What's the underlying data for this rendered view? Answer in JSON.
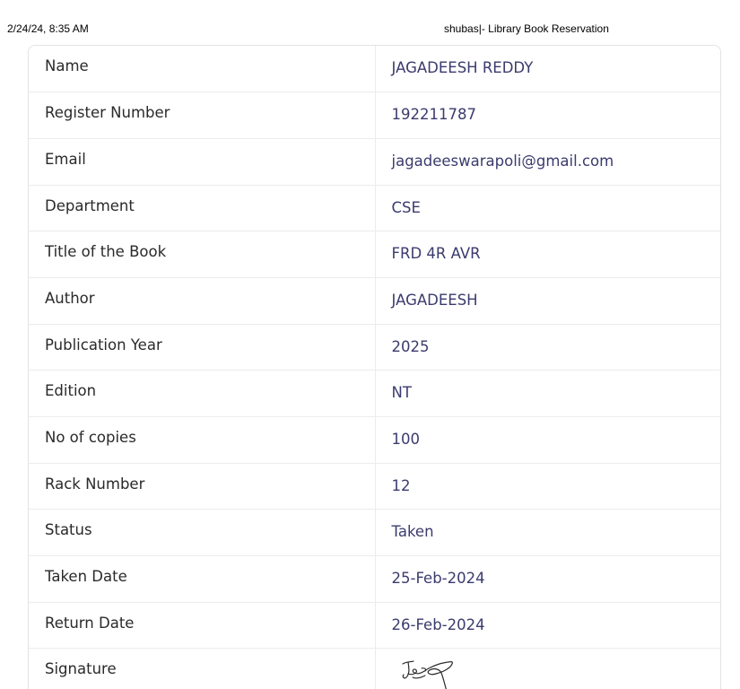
{
  "print_header": {
    "datetime": "2/24/24, 8:35 AM",
    "title": "shubas|- Library Book Reservation"
  },
  "reservation": {
    "rows": [
      {
        "label": "Name",
        "value": "JAGADEESH REDDY"
      },
      {
        "label": "Register Number",
        "value": "192211787"
      },
      {
        "label": "Email",
        "value": "jagadeeswarapoli@gmail.com"
      },
      {
        "label": "Department",
        "value": "CSE"
      },
      {
        "label": "Title of the Book",
        "value": "FRD 4R AVR"
      },
      {
        "label": "Author",
        "value": "JAGADEESH"
      },
      {
        "label": "Publication Year",
        "value": "2025"
      },
      {
        "label": "Edition",
        "value": "NT"
      },
      {
        "label": "No of copies",
        "value": "100"
      },
      {
        "label": "Rack Number",
        "value": "12"
      },
      {
        "label": "Status",
        "value": "Taken"
      },
      {
        "label": "Taken Date",
        "value": "25-Feb-2024"
      },
      {
        "label": "Return Date",
        "value": "26-Feb-2024"
      }
    ],
    "signature_label": "Signature"
  },
  "colors": {
    "label_text": "#2a2a2a",
    "value_text": "#3b3b6e",
    "border": "#ececec"
  }
}
